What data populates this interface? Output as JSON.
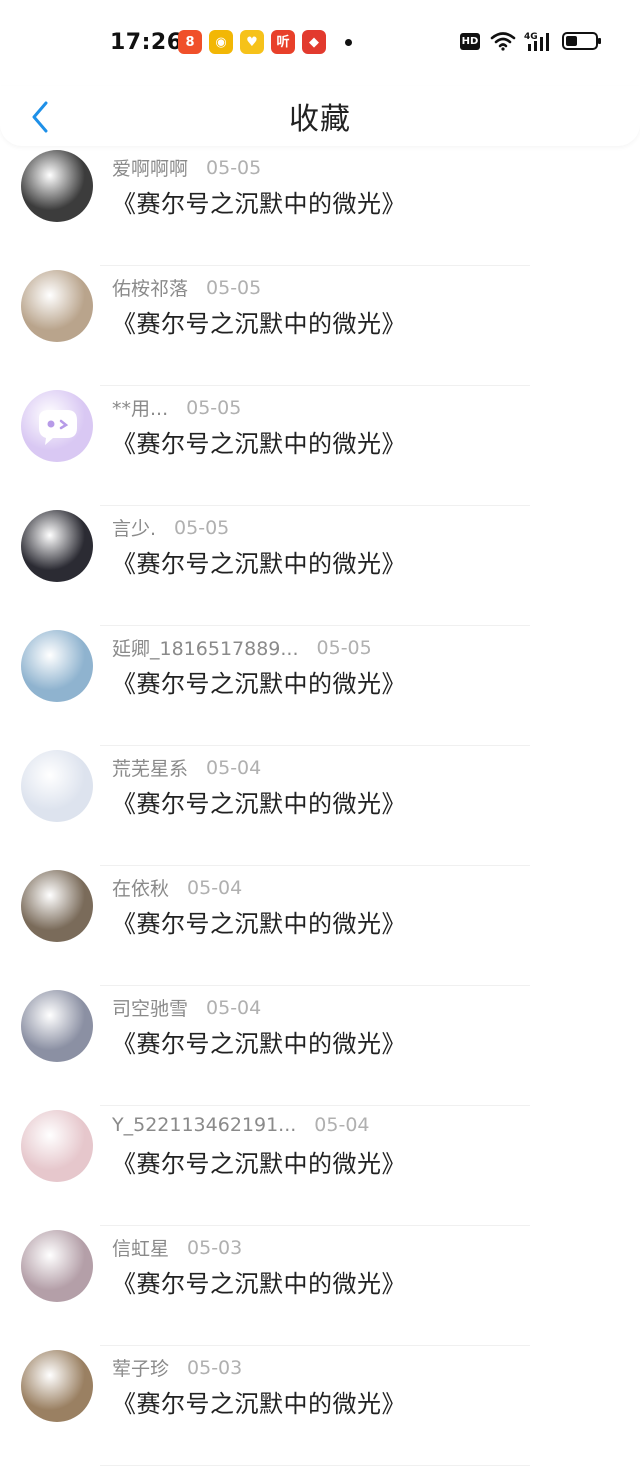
{
  "status_bar": {
    "time": "17:26",
    "apps": [
      {
        "icon": "app-icon-1",
        "glyph": "8",
        "color": "#f0502a"
      },
      {
        "icon": "weibo-icon",
        "glyph": "◉",
        "color": "#f2b705"
      },
      {
        "icon": "app-icon-3",
        "glyph": "♥",
        "color": "#f6c21a"
      },
      {
        "icon": "ting-icon",
        "glyph": "听",
        "color": "#e8402a"
      },
      {
        "icon": "app-icon-5",
        "glyph": "◆",
        "color": "#e23a2e"
      }
    ],
    "hd_label": "HD",
    "network_label": "4G",
    "battery_level": 0.4
  },
  "navbar": {
    "title": "收藏",
    "back_icon": "chevron-left-icon",
    "accent": "#1e90e8"
  },
  "items": [
    {
      "name": "爱啊啊啊",
      "date": "05-05",
      "work": "《赛尔号之沉默中的微光》",
      "avatar_color": "#3c3c3c"
    },
    {
      "name": "佑桉祁落",
      "date": "05-05",
      "work": "《赛尔号之沉默中的微光》",
      "avatar_color": "#b9a48c"
    },
    {
      "name": "**用...",
      "date": "05-05",
      "work": "《赛尔号之沉默中的微光》",
      "avatar_color": "#d9c8f3"
    },
    {
      "name": "言少.",
      "date": "05-05",
      "work": "《赛尔号之沉默中的微光》",
      "avatar_color": "#2b2b33"
    },
    {
      "name": "延卿_1816517889...",
      "date": "05-05",
      "work": "《赛尔号之沉默中的微光》",
      "avatar_color": "#8fb3cf"
    },
    {
      "name": "荒芜星系",
      "date": "05-04",
      "work": "《赛尔号之沉默中的微光》",
      "avatar_color": "#dde3ee"
    },
    {
      "name": "在依秋",
      "date": "05-04",
      "work": "《赛尔号之沉默中的微光》",
      "avatar_color": "#7a6b5a"
    },
    {
      "name": "司空驰雪",
      "date": "05-04",
      "work": "《赛尔号之沉默中的微光》",
      "avatar_color": "#8b90a3"
    },
    {
      "name": "Y_522113462191...",
      "date": "05-04",
      "work": "《赛尔号之沉默中的微光》",
      "avatar_color": "#e6c7cc"
    },
    {
      "name": "信虹星",
      "date": "05-03",
      "work": "《赛尔号之沉默中的微光》",
      "avatar_color": "#b49fa8"
    },
    {
      "name": "荤子珍",
      "date": "05-03",
      "work": "《赛尔号之沉默中的微光》",
      "avatar_color": "#9a8062"
    }
  ]
}
